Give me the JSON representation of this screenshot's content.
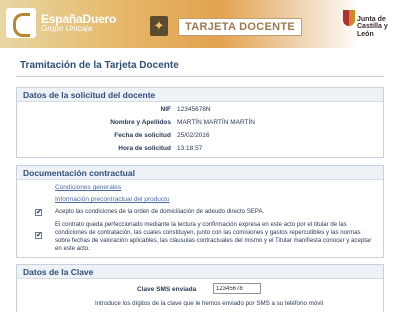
{
  "header": {
    "espanaduero_name": "EspañaDuero",
    "espanaduero_sub": "Grupo Unicaja",
    "tarjeta_title": "TARJETA DOCENTE",
    "jcyl_line1": "Junta de",
    "jcyl_line2": "Castilla y León"
  },
  "page": {
    "title": "Tramitación de la Tarjeta Docente"
  },
  "solicitud": {
    "heading": "Datos de la solicitud del docente",
    "fields": [
      {
        "label": "NIF",
        "value": "12345678N"
      },
      {
        "label": "Nombre y Apellidos",
        "value": "MARTÍN MARTÍN MARTÍN"
      },
      {
        "label": "Fecha de solicitud",
        "value": "25/02/2016"
      },
      {
        "label": "Hora de solicitud",
        "value": "13:18:57"
      }
    ]
  },
  "documentacion": {
    "heading": "Documentación contractual",
    "links": [
      "Condiciones generales",
      "Información precontractual del producto"
    ],
    "checks": [
      {
        "checked": "✔",
        "text": "Acepto las condiciones de la orden de domiciliación de adeudo directo SEPA."
      },
      {
        "checked": "✔",
        "text": "El contrato queda perfeccionado mediante la lectura y confirmación expresa en este acto por el titular de las condiciones de contratación, las cuales constituyen, junto con las comisiones y gastos repercutibles y las normas sobre fechas de valoración aplicables, las cláusulas contractuales del mismo y el Titular manifiesta conocer y aceptar en este acto."
      }
    ]
  },
  "clave": {
    "heading": "Datos de la Clave",
    "label": "Clave SMS enviada",
    "value": "12345678",
    "help": "Introduce los dígitos de la clave que le hemos enviado por SMS a su teléfono móvil"
  }
}
